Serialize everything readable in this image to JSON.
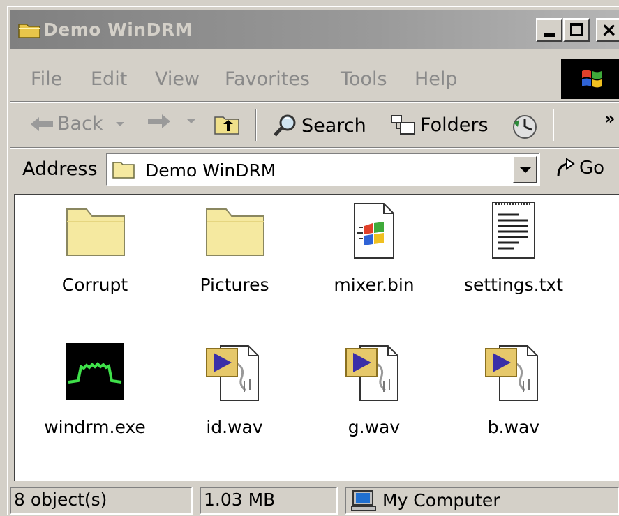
{
  "window": {
    "title": "Demo WinDRM"
  },
  "menu": [
    "File",
    "Edit",
    "View",
    "Favorites",
    "Tools",
    "Help"
  ],
  "toolbar": {
    "back": "Back",
    "search": "Search",
    "folders": "Folders",
    "chevron": "»"
  },
  "address": {
    "label": "Address",
    "value": "Demo WinDRM",
    "go": "Go"
  },
  "files": [
    {
      "name": "Corrupt",
      "icon": "folder-icon"
    },
    {
      "name": "Pictures",
      "icon": "folder-icon"
    },
    {
      "name": "mixer.bin",
      "icon": "windows-file-icon"
    },
    {
      "name": "settings.txt",
      "icon": "text-file-icon"
    },
    {
      "name": "windrm.exe",
      "icon": "windrm-exe-icon"
    },
    {
      "name": "id.wav",
      "icon": "wav-file-icon"
    },
    {
      "name": "g.wav",
      "icon": "wav-file-icon"
    },
    {
      "name": "b.wav",
      "icon": "wav-file-icon"
    }
  ],
  "status": {
    "objects": "8 object(s)",
    "size": "1.03 MB",
    "zone": "My Computer"
  },
  "colors": {
    "folder": "#f5e9a0",
    "title_bar": "#808080",
    "face": "#d4d0c8"
  }
}
